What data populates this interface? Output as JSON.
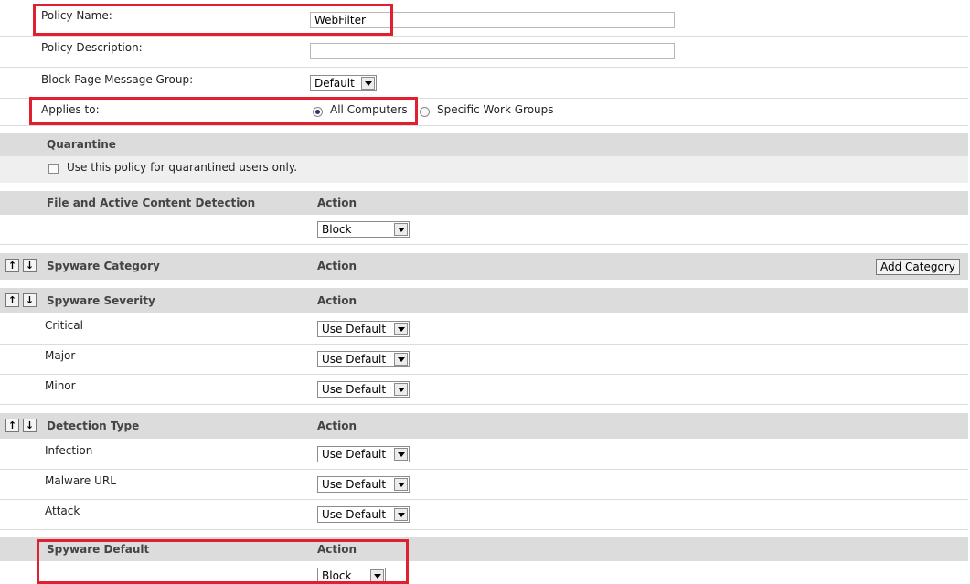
{
  "form": {
    "policy_name_label": "Policy Name:",
    "policy_name_value": "WebFilter",
    "policy_description_label": "Policy Description:",
    "policy_description_value": "",
    "block_page_label": "Block Page Message Group:",
    "block_page_value": "Default",
    "applies_to_label": "Applies to:",
    "applies_all_label": "All Computers",
    "applies_specific_label": "Specific Work Groups",
    "applies_selected": "All Computers"
  },
  "quarantine": {
    "title": "Quarantine",
    "checkbox_label": "Use this policy for quarantined users only.",
    "checked": false
  },
  "file_active": {
    "title": "File and Active Content Detection",
    "action_header": "Action",
    "action_value": "Block"
  },
  "spyware_category": {
    "title": "Spyware Category",
    "action_header": "Action",
    "add_button": "Add Category"
  },
  "spyware_severity": {
    "title": "Spyware Severity",
    "action_header": "Action",
    "rows": [
      {
        "label": "Critical",
        "action": "Use Default"
      },
      {
        "label": "Major",
        "action": "Use Default"
      },
      {
        "label": "Minor",
        "action": "Use Default"
      }
    ]
  },
  "detection_type": {
    "title": "Detection Type",
    "action_header": "Action",
    "rows": [
      {
        "label": "Infection",
        "action": "Use Default"
      },
      {
        "label": "Malware URL",
        "action": "Use Default"
      },
      {
        "label": "Attack",
        "action": "Use Default"
      }
    ]
  },
  "spyware_default": {
    "title": "Spyware Default",
    "action_header": "Action",
    "action_value": "Block"
  },
  "icons": {
    "move_up": "up-arrow-icon",
    "move_down": "down-arrow-icon",
    "dropdown": "chevron-down-icon"
  },
  "colors": {
    "highlight": "#e0202e",
    "section_header": "#dcdcdc"
  }
}
